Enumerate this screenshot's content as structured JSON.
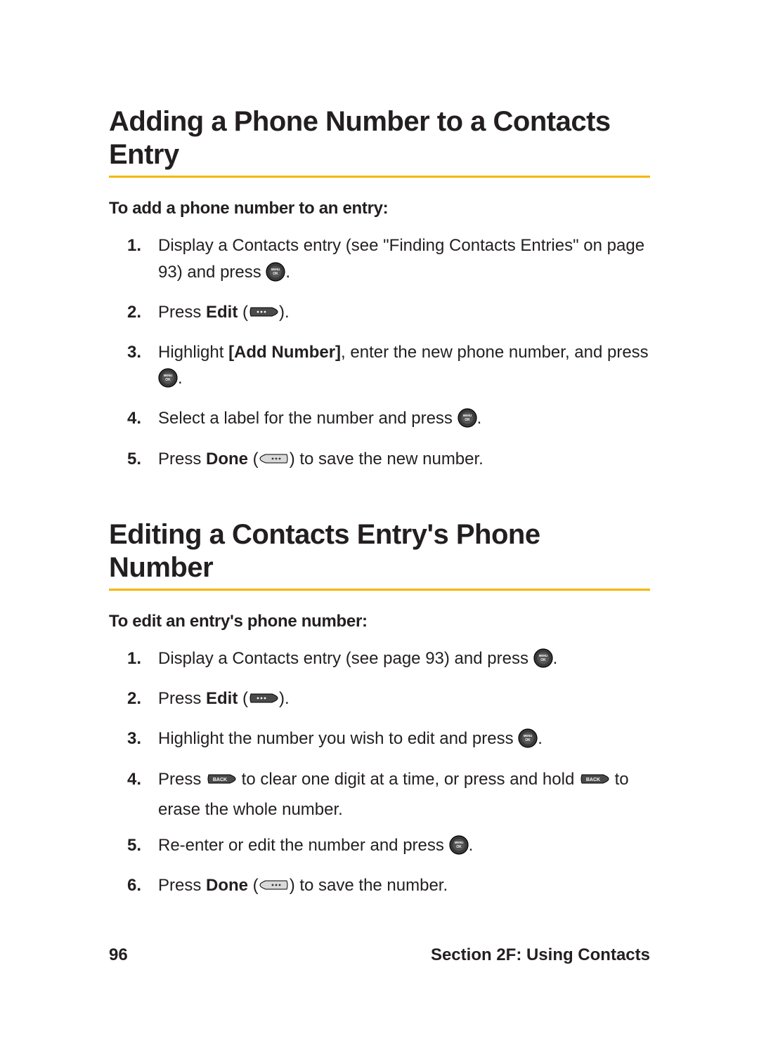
{
  "section_a": {
    "heading": "Adding a Phone Number to a Contacts Entry",
    "subhead": "To add a phone number to an entry:",
    "steps": [
      {
        "n": "1.",
        "pre": "Display a Contacts entry (see \"Finding Contacts Entries\" on page 93) and press ",
        "post": "."
      },
      {
        "n": "2.",
        "pre": "Press ",
        "bold": "Edit",
        "mid": " (",
        "post": ")."
      },
      {
        "n": "3.",
        "pre": "Highlight ",
        "bold": "[Add Number]",
        "mid": ", enter the new phone number, and press ",
        "post": "."
      },
      {
        "n": "4.",
        "pre": "Select a label for the number and press ",
        "post": "."
      },
      {
        "n": "5.",
        "pre": "Press ",
        "bold": "Done",
        "mid": " (",
        "post": ") to save the new number."
      }
    ]
  },
  "section_b": {
    "heading": "Editing a Contacts Entry's Phone Number",
    "subhead": "To edit an entry's phone number:",
    "steps": [
      {
        "n": "1.",
        "pre": "Display a Contacts entry (see page 93) and press ",
        "post": "."
      },
      {
        "n": "2.",
        "pre": "Press ",
        "bold": "Edit",
        "mid": " (",
        "post": ")."
      },
      {
        "n": "3.",
        "pre": "Highlight the number you wish to edit and press ",
        "post": "."
      },
      {
        "n": "4.",
        "pre": "Press ",
        "mid": " to clear one digit at a time, or press and hold ",
        "post": " to erase the whole number."
      },
      {
        "n": "5.",
        "pre": "Re-enter or edit the number and press ",
        "post": "."
      },
      {
        "n": "6.",
        "pre": "Press ",
        "bold": "Done",
        "mid": " (",
        "post": ") to save the number."
      }
    ]
  },
  "footer": {
    "page": "96",
    "section": "Section 2F: Using Contacts"
  },
  "icons": {
    "ok": "menu-ok-button-icon",
    "softkey_right": "right-softkey-icon",
    "softkey_left": "left-softkey-icon",
    "back": "back-key-icon"
  }
}
